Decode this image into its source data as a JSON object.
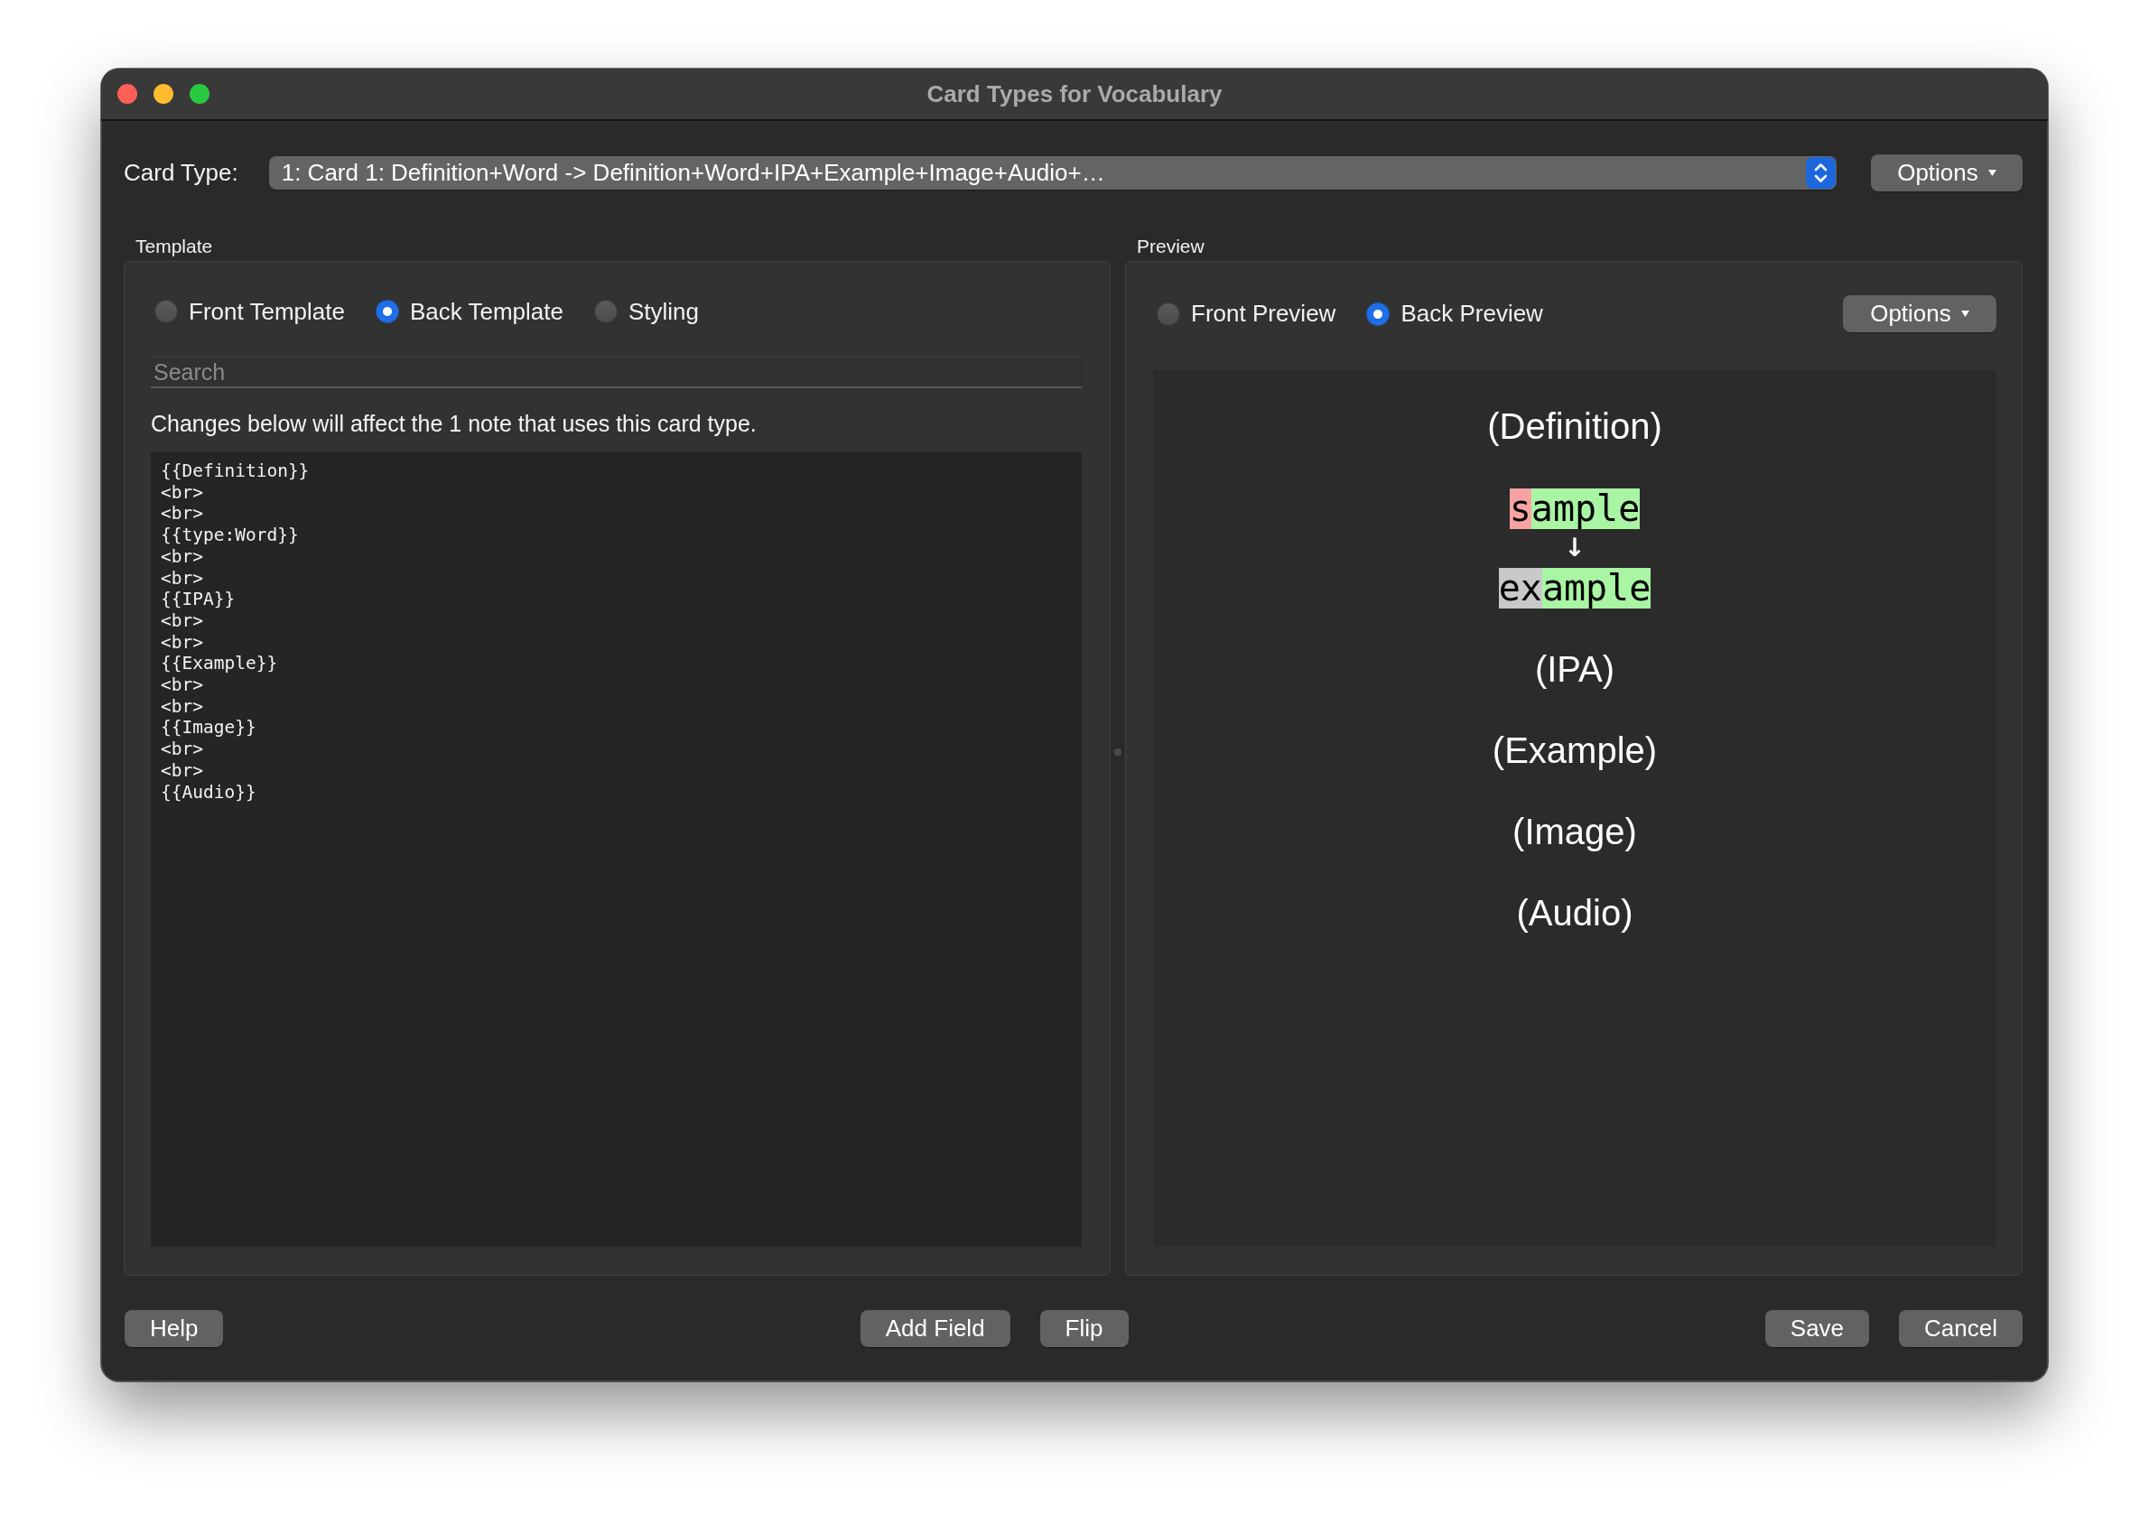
{
  "window": {
    "title": "Card Types for Vocabulary"
  },
  "card_type": {
    "label": "Card Type:",
    "value": "1: Card 1: Definition+Word -> Definition+Word+IPA+Example+Image+Audio+…",
    "options_button": "Options"
  },
  "template": {
    "title": "Template",
    "modes": [
      {
        "label": "Front Template",
        "selected": false
      },
      {
        "label": "Back Template",
        "selected": true
      },
      {
        "label": "Styling",
        "selected": false
      }
    ],
    "search": {
      "placeholder": "Search"
    },
    "notice": "Changes below will affect the 1 note that uses this card type.",
    "code": [
      "{{Definition}}",
      "<br>",
      "<br>",
      "{{type:Word}}",
      "<br>",
      "<br>",
      "{{IPA}}",
      "<br>",
      "<br>",
      "{{Example}}",
      "<br>",
      "<br>",
      "{{Image}}",
      "<br>",
      "<br>",
      "{{Audio}}"
    ]
  },
  "preview": {
    "title": "Preview",
    "modes": [
      {
        "label": "Front Preview",
        "selected": false
      },
      {
        "label": "Back Preview",
        "selected": true
      }
    ],
    "options_button": "Options",
    "content": [
      {
        "kind": "field",
        "text": "(Definition)"
      },
      {
        "kind": "type_compare",
        "typed": [
          {
            "text": "s",
            "color": "#f7a3a3"
          },
          {
            "text": "ample",
            "color": "#a9f5a3"
          }
        ],
        "arrow": "↓",
        "expected": [
          {
            "text": "ex",
            "color": "#c8c8c8"
          },
          {
            "text": "ample",
            "color": "#a9f5a3"
          }
        ]
      },
      {
        "kind": "field",
        "text": "(IPA)"
      },
      {
        "kind": "field",
        "text": "(Example)"
      },
      {
        "kind": "field",
        "text": "(Image)"
      },
      {
        "kind": "field",
        "text": "(Audio)"
      }
    ]
  },
  "footer": {
    "left": [
      "Help"
    ],
    "center": [
      "Add Field",
      "Flip"
    ],
    "right": [
      "Save",
      "Cancel"
    ]
  }
}
